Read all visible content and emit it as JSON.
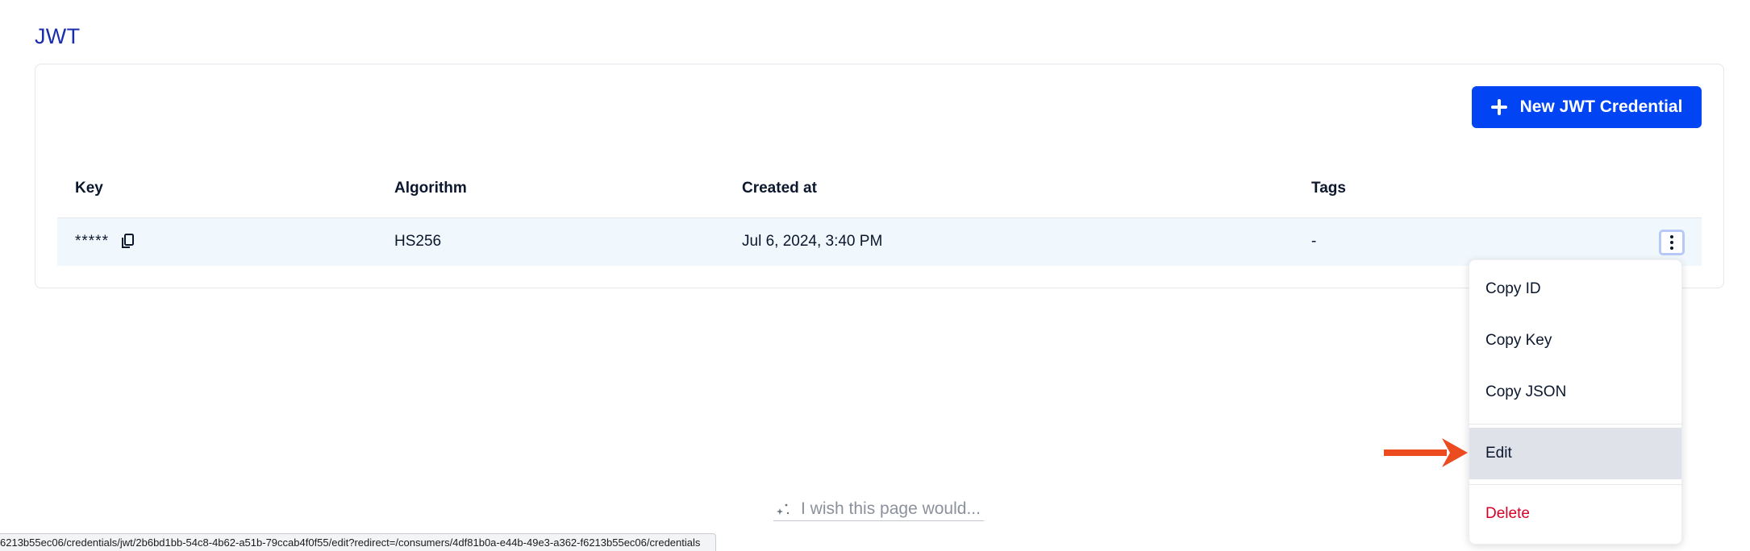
{
  "section": {
    "title": "JWT"
  },
  "actions": {
    "new_credential_label": "New JWT Credential"
  },
  "table": {
    "headers": {
      "key": "Key",
      "algorithm": "Algorithm",
      "created_at": "Created at",
      "tags": "Tags"
    },
    "rows": [
      {
        "key": "*****",
        "algorithm": "HS256",
        "created_at": "Jul 6, 2024, 3:40 PM",
        "tags": "-"
      }
    ]
  },
  "menu": {
    "items": [
      {
        "label": "Copy ID"
      },
      {
        "label": "Copy Key"
      },
      {
        "label": "Copy JSON"
      },
      {
        "label": "Edit",
        "active": true
      },
      {
        "label": "Delete",
        "danger": true
      }
    ]
  },
  "wish": {
    "placeholder": "I wish this page would..."
  },
  "status_bar": {
    "url": "6213b55ec06/credentials/jwt/2b6bd1bb-54c8-4b62-a51b-79ccab4f0f55/edit?redirect=/consumers/4df81b0a-e44b-49e3-a362-f6213b55ec06/credentials"
  },
  "colors": {
    "title": "#1a2cae",
    "primary_button": "#0044f4",
    "row_highlight": "#f0f8fd",
    "danger": "#d60027",
    "arrow": "#ec4a1f"
  }
}
